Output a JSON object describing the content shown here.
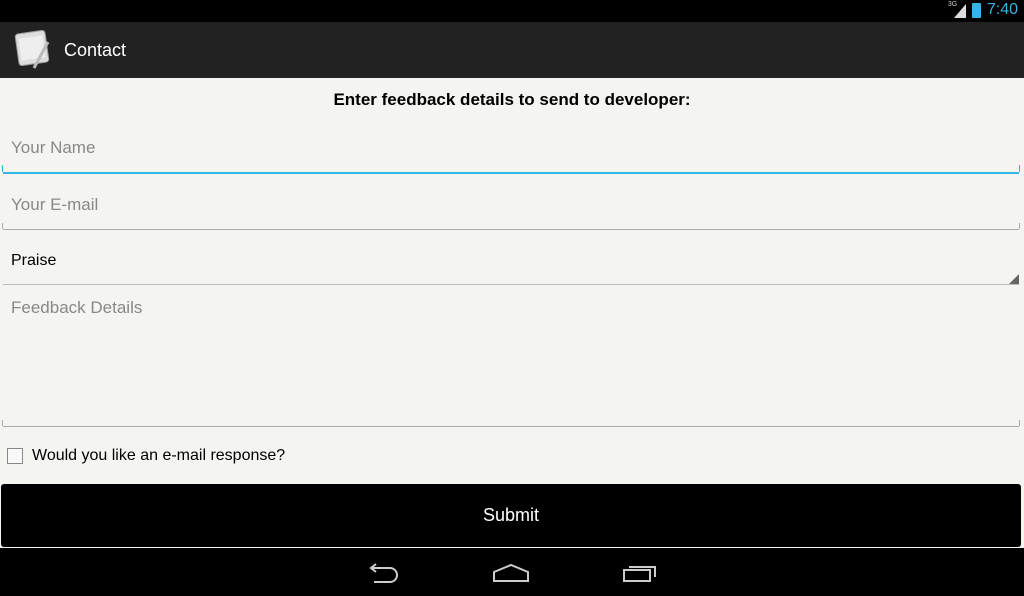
{
  "status_bar": {
    "network": "3G",
    "time": "7:40",
    "icons": [
      "signal-icon",
      "battery-charging-icon"
    ]
  },
  "action_bar": {
    "title": "Contact",
    "icon": "notepad-pencil-app-icon"
  },
  "form": {
    "heading": "Enter feedback details to send to developer:",
    "name_placeholder": "Your Name",
    "email_placeholder": "Your E-mail",
    "type_selected": "Praise",
    "details_placeholder": "Feedback Details",
    "email_response_label": "Would you like an e-mail response?",
    "email_response_checked": false,
    "submit_label": "Submit"
  },
  "nav_bar": {
    "icons": [
      "back-icon",
      "home-icon",
      "recent-apps-icon"
    ]
  },
  "colors": {
    "accent": "#33b5e5",
    "action_bar": "#222222",
    "background": "#f4f4f0"
  }
}
